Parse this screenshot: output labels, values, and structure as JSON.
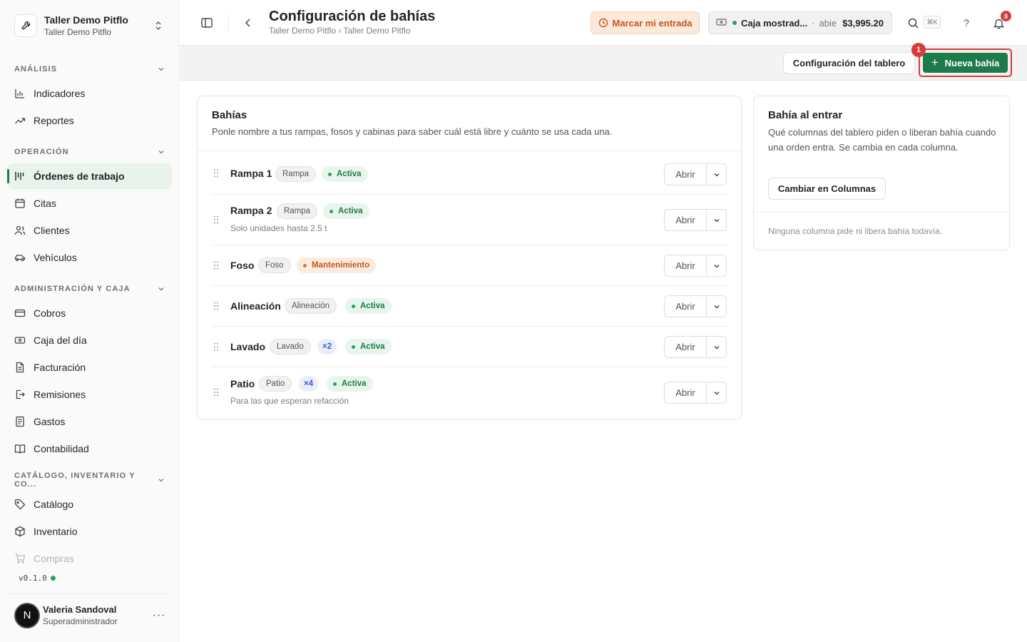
{
  "org": {
    "name": "Taller Demo Pitflo",
    "sub": "Taller Demo Pitflo"
  },
  "sidebar": {
    "sections": [
      {
        "label": "ANÁLISIS"
      },
      {
        "label": "OPERACIÓN"
      },
      {
        "label": "ADMINISTRACIÓN Y CAJA"
      },
      {
        "label": "CATÁLOGO, INVENTARIO Y CO..."
      }
    ],
    "items": [
      {
        "label": "Indicadores",
        "icon": "bar-chart-icon"
      },
      {
        "label": "Reportes",
        "icon": "trend-icon"
      },
      {
        "label": "Órdenes de trabajo",
        "icon": "kanban-icon",
        "active": true
      },
      {
        "label": "Citas",
        "icon": "calendar-icon"
      },
      {
        "label": "Clientes",
        "icon": "users-icon"
      },
      {
        "label": "Vehículos",
        "icon": "car-icon"
      },
      {
        "label": "Cobros",
        "icon": "wallet-icon"
      },
      {
        "label": "Caja del día",
        "icon": "cash-icon"
      },
      {
        "label": "Facturación",
        "icon": "invoice-icon"
      },
      {
        "label": "Remisiones",
        "icon": "export-icon"
      },
      {
        "label": "Gastos",
        "icon": "receipt-icon"
      },
      {
        "label": "Contabilidad",
        "icon": "book-icon"
      },
      {
        "label": "Catálogo",
        "icon": "tag-icon"
      },
      {
        "label": "Inventario",
        "icon": "box-icon"
      },
      {
        "label": "Compras",
        "icon": "cart-icon"
      }
    ],
    "version": "v0.1.0"
  },
  "user": {
    "initial": "N",
    "name": "Valeria Sandoval",
    "role": "Superadministrador"
  },
  "header": {
    "title": "Configuración de bahías",
    "breadcrumb": "Taller Demo Pitflo › Taller Demo Pitflo",
    "clock_in": "Marcar mi entrada",
    "cashbox": {
      "name": "Caja mostrad...",
      "separator": "·",
      "status": "abie",
      "amount": "$3,995.20"
    },
    "shortcut": "⌘K",
    "help": "?",
    "notifications": "8"
  },
  "toolbar": {
    "board_config": "Configuración del tablero",
    "new_bay": "Nueva bahía",
    "callout": "1"
  },
  "bays_card": {
    "title": "Bahías",
    "description": "Ponle nombre a tus rampas, fosos y cabinas para saber cuál está libre y cuánto se usa cada una.",
    "open_label": "Abrir",
    "rows": [
      {
        "name": "Rampa 1",
        "type": "Rampa",
        "count": "",
        "status": "Activa",
        "note": ""
      },
      {
        "name": "Rampa 2",
        "type": "Rampa",
        "count": "",
        "status": "Activa",
        "note": "Solo unidades hasta 2.5 t"
      },
      {
        "name": "Foso",
        "type": "Foso",
        "count": "",
        "status": "Mantenimiento",
        "note": ""
      },
      {
        "name": "Alineación",
        "type": "Alineación",
        "count": "",
        "status": "Activa",
        "note": ""
      },
      {
        "name": "Lavado",
        "type": "Lavado",
        "count": "×2",
        "status": "Activa",
        "note": ""
      },
      {
        "name": "Patio",
        "type": "Patio",
        "count": "×4",
        "status": "Activa",
        "note": "Para las que esperan refacción"
      }
    ]
  },
  "side_card": {
    "title": "Bahía al entrar",
    "description": "Qué columnas del tablero piden o liberan bahía cuando una orden entra. Se cambia en cada columna.",
    "button": "Cambiar en Columnas",
    "empty": "Ninguna columna pide ni libera bahía todavía."
  },
  "colors": {
    "accent": "#1d7a4a",
    "highlight": "#d83a3a",
    "warning": "#c2581b"
  }
}
